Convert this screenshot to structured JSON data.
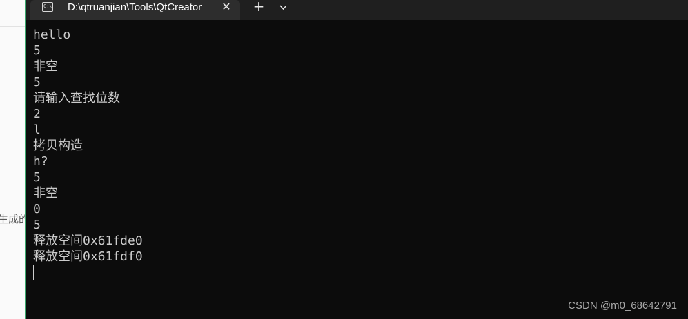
{
  "background": {
    "text": "生成的"
  },
  "window": {
    "tab_title": "D:\\qtruanjian\\Tools\\QtCreator",
    "icon_text": "C:\\",
    "close_label": "✕",
    "new_tab_label": "+"
  },
  "console": {
    "lines": [
      "hello",
      "5",
      "非空",
      "5",
      "请输入查找位数",
      "2",
      "l",
      "拷贝构造",
      "h?",
      "5",
      "非空",
      "0",
      "5",
      "释放空间0x61fde0",
      "释放空间0x61fdf0"
    ]
  },
  "watermark": "CSDN @m0_68642791",
  "colors": {
    "terminal_bg": "#0c0c0c",
    "tab_bg": "#2d2d2d",
    "titlebar_bg": "#1f1f1f",
    "text": "#cccccc",
    "accent_edge": "#3aa56c"
  }
}
